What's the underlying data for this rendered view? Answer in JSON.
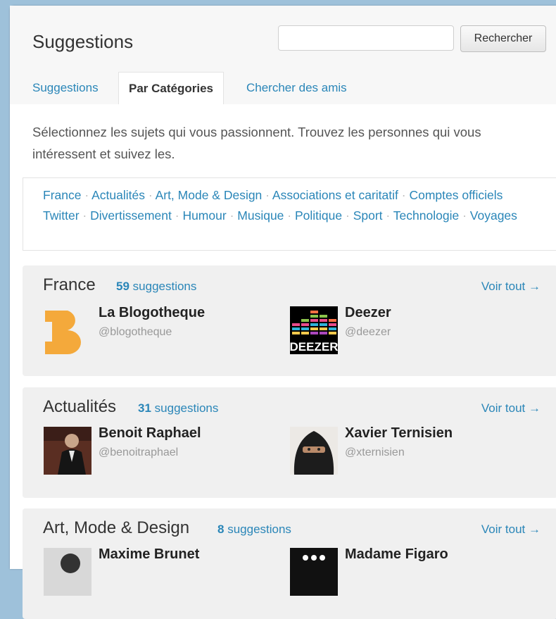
{
  "header": {
    "title": "Suggestions",
    "search_placeholder": "",
    "search_button": "Rechercher"
  },
  "tabs": [
    {
      "label": "Suggestions",
      "active": false
    },
    {
      "label": "Par Catégories",
      "active": true
    },
    {
      "label": "Chercher des amis",
      "active": false
    }
  ],
  "intro": "Sélectionnez les sujets qui vous passionnent. Trouvez les personnes qui vous intéressent et suivez les.",
  "categories": [
    "France",
    "Actualités",
    "Art, Mode & Design",
    "Associations et caritatif",
    "Comptes officiels Twitter",
    "Divertissement",
    "Humour",
    "Musique",
    "Politique",
    "Sport",
    "Technologie",
    "Voyages"
  ],
  "separator": "·",
  "sections": [
    {
      "title": "France",
      "count": "59",
      "count_suffix": "suggestions",
      "see_all": "Voir tout →",
      "users": [
        {
          "name": "La Blogotheque",
          "handle": "@blogotheque",
          "avatar": "blogotheque-logo-icon"
        },
        {
          "name": "Deezer",
          "handle": "@deezer",
          "avatar": "deezer-logo-icon",
          "logo_text": "DEEZER"
        }
      ]
    },
    {
      "title": "Actualités",
      "count": "31",
      "count_suffix": "suggestions",
      "see_all": "Voir tout →",
      "users": [
        {
          "name": "Benoit Raphael",
          "handle": "@benoitraphael",
          "avatar": "person-photo-icon"
        },
        {
          "name": "Xavier Ternisien",
          "handle": "@xternisien",
          "avatar": "person-photo-icon"
        }
      ]
    },
    {
      "title": "Art, Mode & Design",
      "count": "8",
      "count_suffix": "suggestions",
      "see_all": "Voir tout →",
      "users": [
        {
          "name": "Maxime Brunet",
          "handle": "",
          "avatar": "person-photo-icon"
        },
        {
          "name": "Madame Figaro",
          "handle": "",
          "avatar": "madame-figaro-logo-icon"
        }
      ]
    }
  ],
  "colors": {
    "link": "#2a86b8",
    "page_bg": "#9ec1da",
    "section_bg": "#f0f0f0",
    "blogotheque": "#f4a93b"
  }
}
